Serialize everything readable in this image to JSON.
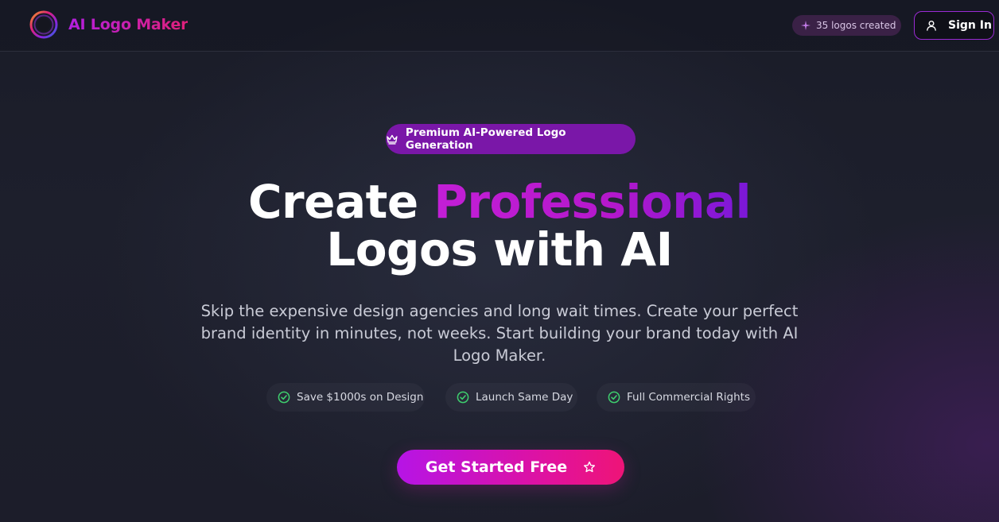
{
  "header": {
    "brand_name": "AI Logo Maker",
    "logos_created": "35 logos created",
    "sign_in_label": "Sign In"
  },
  "hero": {
    "badge": "Premium AI-Powered Logo Generation",
    "headline_part1": "Create ",
    "headline_highlight": "Professional",
    "headline_part2": "Logos with AI",
    "subheading": "Skip the expensive design agencies and long wait times. Create your perfect brand identity in minutes, not weeks. Start building your brand today with AI Logo Maker.",
    "features": [
      {
        "label": "Save $1000s on Design",
        "icon": "check-circle-icon"
      },
      {
        "label": "Launch Same Day",
        "icon": "check-circle-icon"
      },
      {
        "label": "Full Commercial Rights",
        "icon": "check-circle-icon"
      }
    ],
    "cta_label": "Get Started Free"
  },
  "icons": {
    "brand": "ring-logo-icon",
    "counter": "sparkles-icon",
    "sign_in": "user-icon",
    "badge": "crown-icon",
    "cta": "star-icon"
  },
  "colors": {
    "accent_purple": "#b31fe0",
    "accent_pink": "#e0207a",
    "check_green": "#3ecf6e",
    "background": "#1c1d2a"
  }
}
